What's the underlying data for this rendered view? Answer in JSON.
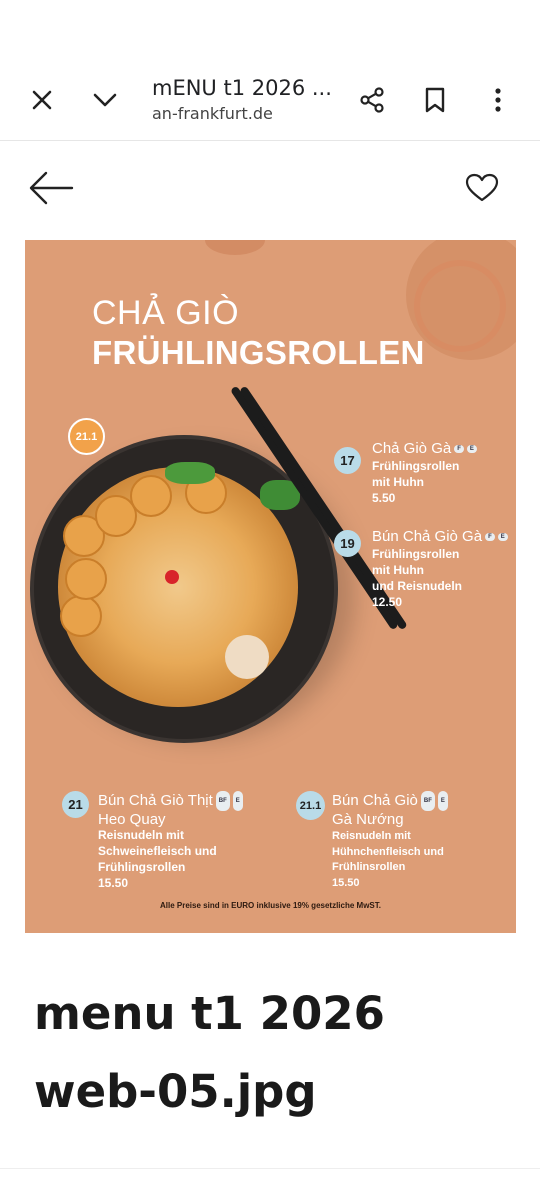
{
  "topbar": {
    "tab_title": "mENU t1 2026 ...",
    "url": "an-frankfurt.de",
    "icons": [
      "close-icon",
      "chevron-down-icon",
      "share-icon",
      "bookmark-icon",
      "more-vert-icon"
    ]
  },
  "nav": {
    "icons": [
      "arrow-left-icon",
      "heart-outline-icon"
    ]
  },
  "menu_image": {
    "title_line1": "CHẢ GIÒ",
    "title_line2": "FRÜHLINGSROLLEN",
    "featured_badge": "21.1",
    "items": [
      {
        "number": "17",
        "name": "Chả Giò Gà",
        "desc_lines": [
          "Frühlingsrollen",
          "mit Huhn"
        ],
        "price": "5.50",
        "tags": [
          "F",
          "E"
        ]
      },
      {
        "number": "19",
        "name": "Bún Chả Giò Gà",
        "desc_lines": [
          "Frühlingsrollen",
          "mit Huhn",
          "und Reisnudeln"
        ],
        "price": "12.50",
        "tags": [
          "F",
          "E"
        ]
      },
      {
        "number": "21",
        "name": "Bún Chả Giò Thịt",
        "name_line2": "Heo Quay",
        "desc_lines": [
          "Reisnudeln mit",
          "Schweinefleisch und",
          "Frühlingsrollen"
        ],
        "price": "15.50",
        "tags": [
          "BF",
          "E"
        ]
      },
      {
        "number": "21.1",
        "name": "Bún Chả Giò",
        "name_line2": "Gà Nướng",
        "desc_lines": [
          "Reisnudeln mit",
          "Hühnchenfleisch und",
          "Frühlinsrollen"
        ],
        "price": "15.50",
        "tags": [
          "BF",
          "E"
        ]
      }
    ],
    "price_note": "Alle Preise sind in EURO inklusive 19% gesetzliche MwST."
  },
  "caption": {
    "line1": "menu t1 2026",
    "line2": "web-05.jpg"
  },
  "colors": {
    "menu_bg": "#dd9d76",
    "badge_blue": "#b9dbe8",
    "badge_orange": "#f2a24a"
  }
}
